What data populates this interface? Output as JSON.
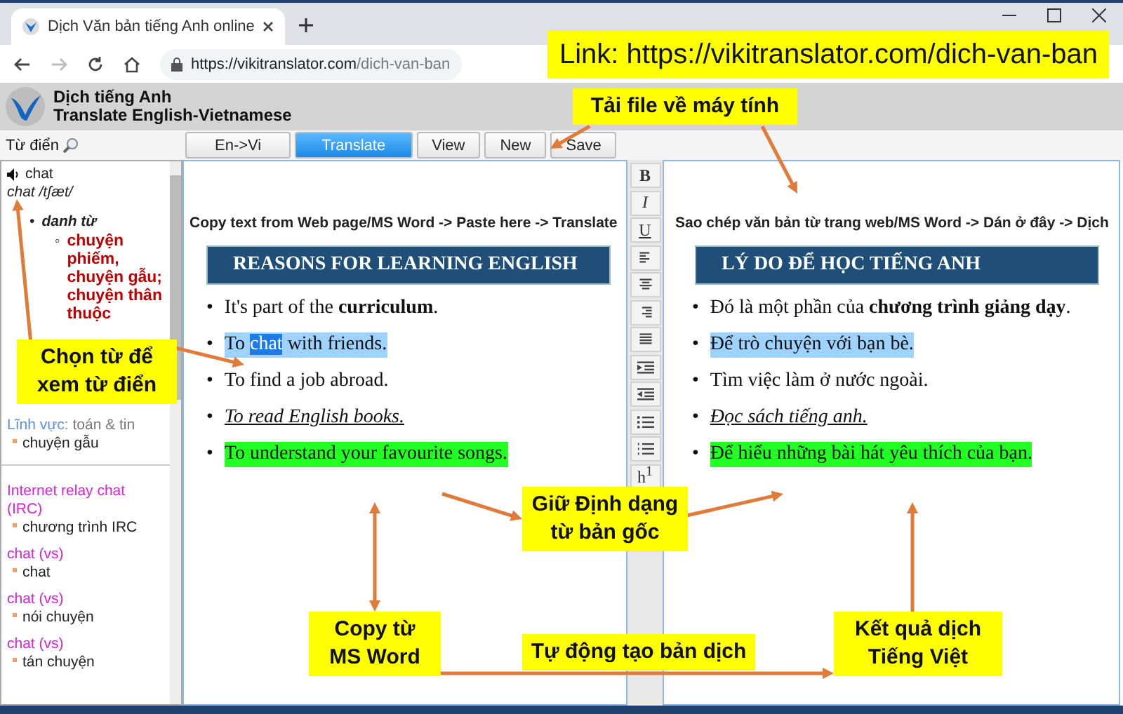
{
  "browser": {
    "tab_title": "Dịch Văn bản tiếng Anh online",
    "url_host": "https://vikitranslator.com",
    "url_path": "/dich-van-ban"
  },
  "app_header": {
    "title": "Dịch tiếng Anh",
    "subtitle": "Translate English-Vietnamese"
  },
  "dictionary": {
    "label": "Từ điển",
    "word": "chat",
    "pronunciation": "chat /tʃæt/",
    "pos_marker": "•",
    "part_of_speech": "danh từ",
    "meaning_marker": "◦",
    "meaning": "chuyện phiếm, chuyện gẫu; chuyện thân thuộc",
    "field_label": "Lĩnh vực:",
    "field": "toán & tin",
    "field_meaning": "chuyện gẫu",
    "entries": [
      {
        "term": "Internet relay chat (IRC)",
        "meaning": "chương trình IRC"
      },
      {
        "term": "chat (vs)",
        "meaning": "chat"
      },
      {
        "term": "chat (vs)",
        "meaning": "nói chuyện"
      },
      {
        "term": "chat (vs)",
        "meaning": "tán chuyện"
      }
    ]
  },
  "toolbar": [
    {
      "label": "En->Vi",
      "selected": false
    },
    {
      "label": "Translate",
      "selected": true
    },
    {
      "label": "View",
      "selected": false
    },
    {
      "label": "New",
      "selected": false
    },
    {
      "label": "Save",
      "selected": false
    }
  ],
  "format_buttons": [
    {
      "kind": "bold",
      "label": "B"
    },
    {
      "kind": "italic",
      "label": "I"
    },
    {
      "kind": "underline",
      "label": "U"
    },
    {
      "kind": "align-left"
    },
    {
      "kind": "align-center"
    },
    {
      "kind": "align-right"
    },
    {
      "kind": "justify"
    },
    {
      "kind": "indent"
    },
    {
      "kind": "outdent"
    },
    {
      "kind": "bullet-list"
    },
    {
      "kind": "numbered-list"
    },
    {
      "kind": "superscript",
      "label": "h$^{1}$"
    }
  ],
  "source": {
    "hint": "Copy text from Web page/MS Word -> Paste here -> Translate",
    "heading": "REASONS FOR LEARNING ENGLISH",
    "items": [
      {
        "marker": "•",
        "segments": [
          {
            "text": "It's part of the **curriculum**.",
            "selected": false
          }
        ],
        "emphasis": false
      },
      {
        "marker": "•",
        "segments": [
          {
            "text": "To ",
            "selected": false
          },
          {
            "text": "chat",
            "selected": true
          },
          {
            "text": " with friends.",
            "selected": false
          }
        ],
        "color": "#9fd3ff",
        "emphasis": false
      },
      {
        "marker": "•",
        "segments": [
          {
            "text": "To find a job abroad.",
            "selected": false
          }
        ],
        "emphasis": false
      },
      {
        "marker": "•",
        "segments": [
          {
            "text": "To read English books.",
            "selected": false
          }
        ],
        "emphasis": true
      },
      {
        "marker": "•",
        "segments": [
          {
            "text": "To understand your favourite songs.",
            "selected": false
          }
        ],
        "color": "#22ff22",
        "emphasis": false
      }
    ]
  },
  "translation": {
    "hint": "Sao chép văn bản từ trang web/MS Word -> Dán ở đây -> Dịch",
    "heading": "LÝ DO ĐỂ HỌC TIẾNG ANH",
    "items": [
      {
        "marker": "•",
        "segments": [
          {
            "text": "Đó là một phần của **chương trình giảng dạy**.",
            "selected": false
          }
        ],
        "emphasis": false
      },
      {
        "marker": "•",
        "segments": [
          {
            "text": "Để trò chuyện với bạn bè.",
            "selected": false
          }
        ],
        "color": "#9fd3ff",
        "emphasis": false
      },
      {
        "marker": "•",
        "segments": [
          {
            "text": "Tìm việc làm ở nước ngoài.",
            "selected": false
          }
        ],
        "emphasis": false
      },
      {
        "marker": "•",
        "segments": [
          {
            "text": "Đọc sách tiếng anh.",
            "selected": false
          }
        ],
        "emphasis": true
      },
      {
        "marker": "•",
        "segments": [
          {
            "text": "Để hiểu những bài hát yêu thích của bạn.",
            "selected": false
          }
        ],
        "color": "#22ff22",
        "emphasis": false
      }
    ]
  },
  "callouts": [
    {
      "text": "Link: https://vikitranslator.com/dich-van-ban"
    },
    {
      "text": "Tải file về máy tính"
    },
    {
      "text": "Chọn từ để xem từ điển"
    },
    {
      "text": "Giữ Định dạng từ bản gốc"
    },
    {
      "text": "Copy từ MS Word"
    },
    {
      "text": "Tự động tạo bản dịch"
    },
    {
      "text": "Kết quả dịch Tiếng Việt"
    }
  ]
}
